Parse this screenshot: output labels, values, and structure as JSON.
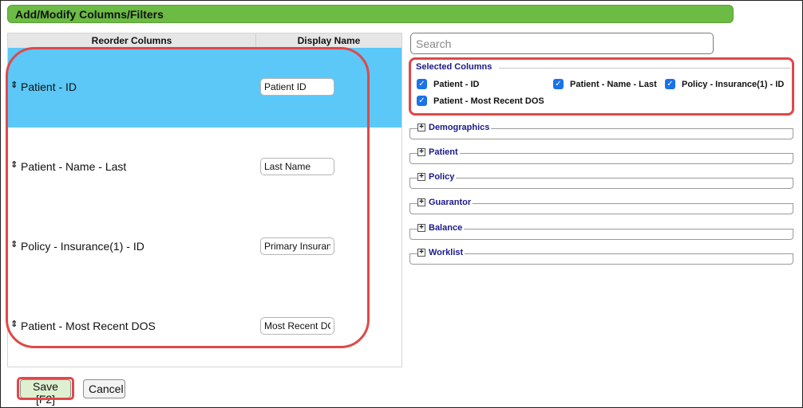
{
  "dialog": {
    "title": "Add/Modify Columns/Filters"
  },
  "left": {
    "headers": {
      "reorder": "Reorder Columns",
      "display": "Display Name"
    },
    "rows": [
      {
        "label": "Patient - ID",
        "display": "Patient ID",
        "selected": true
      },
      {
        "label": "Patient - Name - Last",
        "display": "Last Name",
        "selected": false
      },
      {
        "label": "Policy - Insurance(1) - ID",
        "display": "Primary Insuran",
        "selected": false
      },
      {
        "label": "Patient - Most Recent DOS",
        "display": "Most Recent DO",
        "selected": false
      }
    ],
    "grip_glyph": "⇕"
  },
  "right": {
    "search_placeholder": "Search",
    "selected_columns": {
      "title": "Selected Columns",
      "items": [
        {
          "label": "Patient - ID",
          "checked": true
        },
        {
          "label": "Patient - Name - Last",
          "checked": true
        },
        {
          "label": "Policy - Insurance(1) - ID",
          "checked": true
        },
        {
          "label": "Patient - Most Recent DOS",
          "checked": true
        }
      ]
    },
    "groups": [
      "Demographics",
      "Patient",
      "Policy",
      "Guarantor",
      "Balance",
      "Worklist"
    ]
  },
  "buttons": {
    "save": "Save [F2]",
    "cancel": "Cancel"
  },
  "colors": {
    "title_bar": "#6cbb45",
    "selected_row": "#5bc8f8",
    "highlight": "#e04848",
    "group_text": "#1a1a8a"
  }
}
